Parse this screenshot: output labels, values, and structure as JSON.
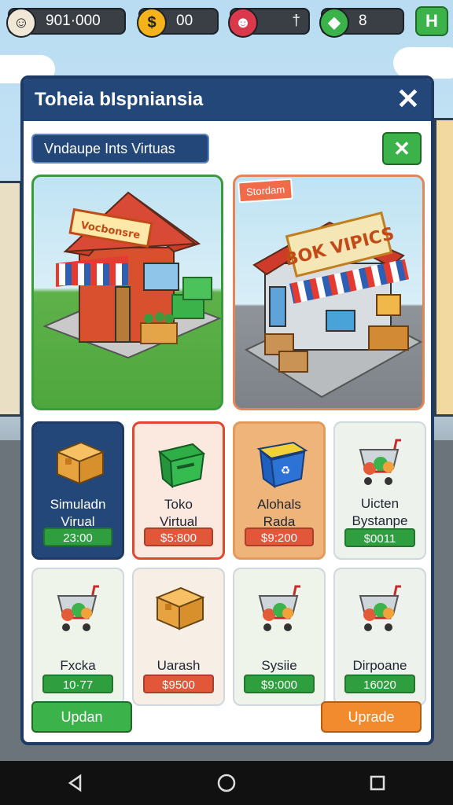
{
  "hud": {
    "money": "901·000",
    "coins": "00",
    "tickets": "†",
    "gems": "8",
    "plus_label": "H"
  },
  "modal": {
    "title": "Toheia bIspniansia",
    "close_label": "✕",
    "subtitle": "Vndaupe Ints Virtuas",
    "green_button_label": "✕",
    "hero_left_sign": "Vocbonsre",
    "hero_right_tag": "Stordam",
    "hero_right_sign": "BOK VIPICS"
  },
  "cards": [
    {
      "name": "Simuladn Virual",
      "price": "23:00",
      "icon": "box-icon",
      "bg": "#24477a",
      "border": "#1f3a63",
      "text": "#ffffff",
      "price_bg": "#2e9e3e"
    },
    {
      "name": "Toko Virtual",
      "price": "$5:800",
      "icon": "bin-icon",
      "bg": "#fbe9e0",
      "border": "#e0472f",
      "text": "#1d2530",
      "price_bg": "#e2563a"
    },
    {
      "name": "Alohals Rada",
      "price": "$9:200",
      "icon": "recycle-bin-icon",
      "bg": "#efb47a",
      "border": "#e39b5b",
      "text": "#1d2530",
      "price_bg": "#e2563a"
    },
    {
      "name": "Uicten Bystanpe",
      "price": "$0011",
      "icon": "cart-icon",
      "bg": "#eef2ec",
      "border": "#cfd8dc",
      "text": "#1d2530",
      "price_bg": "#2e9e3e"
    },
    {
      "name": "Fxcka",
      "price": "10·77",
      "icon": "cart-icon",
      "bg": "#eef4ea",
      "border": "#cfd8dc",
      "text": "#1d2530",
      "price_bg": "#2e9e3e"
    },
    {
      "name": "Uarash",
      "price": "$9500",
      "icon": "box-icon",
      "bg": "#f7efe6",
      "border": "#cfd8dc",
      "text": "#1d2530",
      "price_bg": "#e2563a"
    },
    {
      "name": "Sysiie",
      "price": "$9:000",
      "icon": "cart-icon",
      "bg": "#eef4ea",
      "border": "#cfd8dc",
      "text": "#1d2530",
      "price_bg": "#2e9e3e"
    },
    {
      "name": "Dirpoane",
      "price": "16020",
      "icon": "cart-icon",
      "bg": "#eef2ec",
      "border": "#cfd8dc",
      "text": "#1d2530",
      "price_bg": "#2e9e3e"
    }
  ],
  "buttons": {
    "left": "Updan",
    "right": "Uprade"
  },
  "colors": {
    "header": "#24477a",
    "green": "#3cb34a",
    "orange": "#f28a2e"
  }
}
